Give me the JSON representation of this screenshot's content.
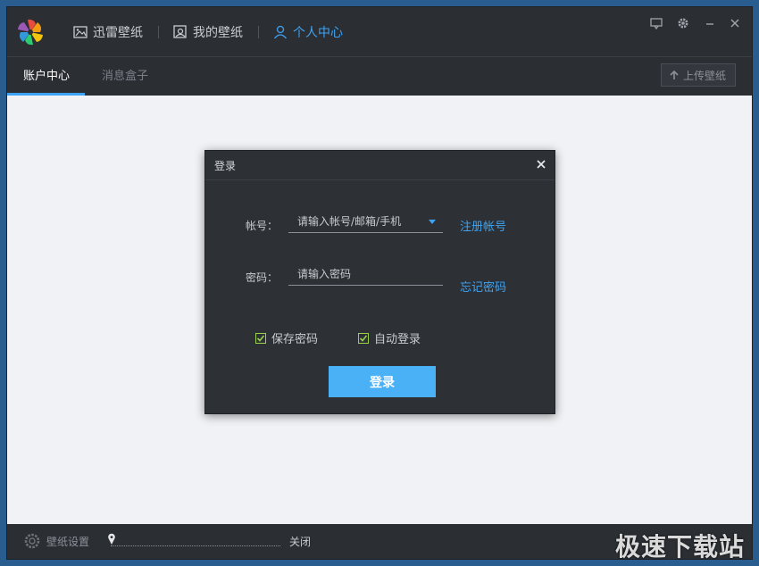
{
  "nav": {
    "items": [
      {
        "label": "迅雷壁纸",
        "icon": "image-icon"
      },
      {
        "label": "我的壁纸",
        "icon": "my-wallpaper-icon"
      },
      {
        "label": "个人中心",
        "icon": "user-icon"
      }
    ],
    "active": "个人中心"
  },
  "window_controls": [
    "feedback-icon",
    "gear-icon",
    "minimize-icon",
    "close-icon"
  ],
  "subtabs": [
    {
      "label": "账户中心",
      "active": true
    },
    {
      "label": "消息盒子",
      "active": false
    }
  ],
  "upload_button": {
    "label": "上传壁纸",
    "icon": "upload-arrow-icon"
  },
  "login_dialog": {
    "title": "登录",
    "account_label": "帐号：",
    "account_placeholder": "请输入帐号/邮箱/手机",
    "register_link": "注册帐号",
    "password_label": "密码：",
    "password_placeholder": "请输入密码",
    "forgot_link": "忘记密码",
    "remember_password": {
      "label": "保存密码",
      "checked": true
    },
    "auto_login": {
      "label": "自动登录",
      "checked": true
    },
    "login_button": "登录"
  },
  "bottom": {
    "settings_label": "壁纸设置",
    "slider_value_label": "关闭"
  },
  "watermark": "极速下载站",
  "colors": {
    "accent": "#3ea3f2",
    "dark_panel": "#2b2e33",
    "check_green": "#9ad14b",
    "login_button": "#4ab1f6"
  }
}
